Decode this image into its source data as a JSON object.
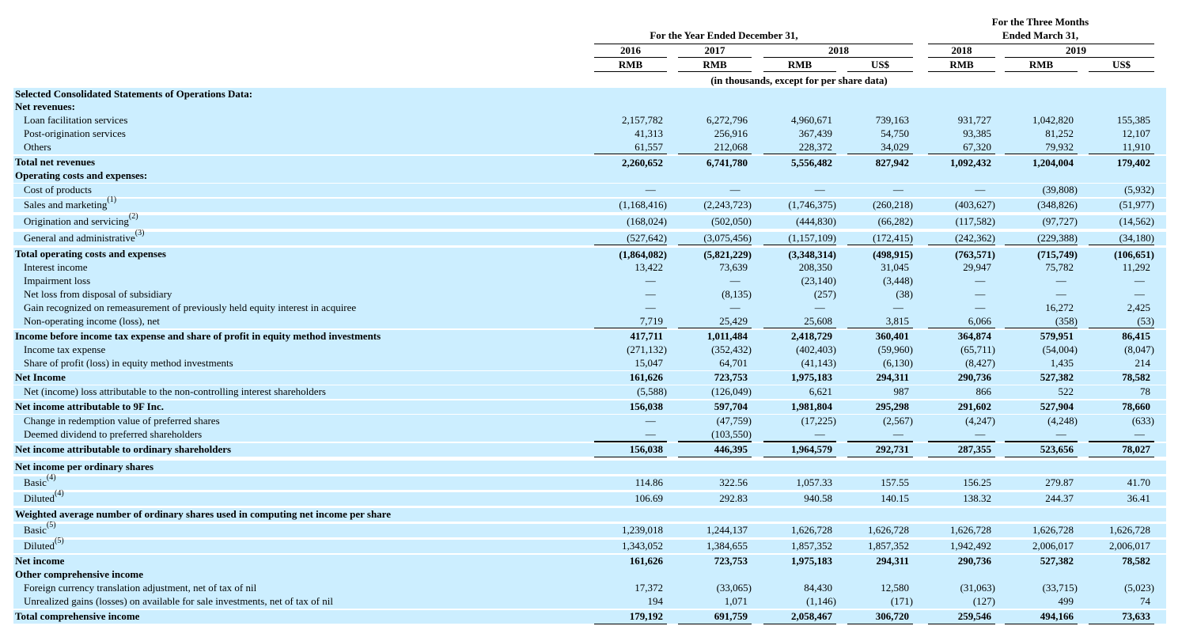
{
  "header": {
    "year_group": "For the Year Ended December 31,",
    "quarter_group_line1": "For the Three Months",
    "quarter_group_line2": "Ended March 31,",
    "year_2018": "2018",
    "quarter_2019": "2019",
    "units_note": "(in thousands, except for per share data)",
    "columns": [
      {
        "year": "2016",
        "currency": "RMB"
      },
      {
        "year": "2017",
        "currency": "RMB"
      },
      {
        "year": "",
        "currency": "RMB"
      },
      {
        "year": "",
        "currency": "US$"
      },
      {
        "year": "2018",
        "currency": "RMB"
      },
      {
        "year": "",
        "currency": "RMB"
      },
      {
        "year": "",
        "currency": "US$"
      }
    ]
  },
  "rows": [
    {
      "label": "Selected Consolidated Statements of Operations Data:",
      "style": "section",
      "values": []
    },
    {
      "label": "Net revenues:",
      "style": "section",
      "values": []
    },
    {
      "label": "Loan facilitation services",
      "style": "item",
      "values": [
        "2,157,782",
        "6,272,796",
        "4,960,671",
        "739,163",
        "931,727",
        "1,042,820",
        "155,385"
      ]
    },
    {
      "label": "Post-origination services",
      "style": "item",
      "values": [
        "41,313",
        "256,916",
        "367,439",
        "54,750",
        "93,385",
        "81,252",
        "12,107"
      ]
    },
    {
      "label": "Others",
      "style": "item",
      "values": [
        "61,557",
        "212,068",
        "228,372",
        "34,029",
        "67,320",
        "79,932",
        "11,910"
      ]
    },
    {
      "label": "Total net revenues",
      "style": "total",
      "values": [
        "2,260,652",
        "6,741,780",
        "5,556,482",
        "827,942",
        "1,092,432",
        "1,204,004",
        "179,402"
      ]
    },
    {
      "label": "Operating costs and expenses:",
      "style": "section",
      "values": []
    },
    {
      "label": "Cost of products",
      "style": "item",
      "values": [
        "—",
        "—",
        "—",
        "—",
        "—",
        "(39,808)",
        "(5,932)"
      ]
    },
    {
      "label": "Sales and marketing",
      "note": "(1)",
      "style": "item",
      "values": [
        "(1,168,416)",
        "(2,243,723)",
        "(1,746,375)",
        "(260,218)",
        "(403,627)",
        "(348,826)",
        "(51,977)"
      ]
    },
    {
      "label": "Origination and servicing",
      "note": "(2)",
      "style": "item",
      "values": [
        "(168,024)",
        "(502,050)",
        "(444,830)",
        "(66,282)",
        "(117,582)",
        "(97,727)",
        "(14,562)"
      ]
    },
    {
      "label": "General and administrative",
      "note": "(3)",
      "style": "item",
      "values": [
        "(527,642)",
        "(3,075,456)",
        "(1,157,109)",
        "(172,415)",
        "(242,362)",
        "(229,388)",
        "(34,180)"
      ]
    },
    {
      "label": "Total operating costs and expenses",
      "style": "total",
      "values": [
        "(1,864,082)",
        "(5,821,229)",
        "(3,348,314)",
        "(498,915)",
        "(763,571)",
        "(715,749)",
        "(106,651)"
      ]
    },
    {
      "label": "Interest income",
      "style": "item",
      "values": [
        "13,422",
        "73,639",
        "208,350",
        "31,045",
        "29,947",
        "75,782",
        "11,292"
      ]
    },
    {
      "label": "Impairment loss",
      "style": "item",
      "values": [
        "—",
        "—",
        "(23,140)",
        "(3,448)",
        "—",
        "—",
        "—"
      ]
    },
    {
      "label": "Net loss from disposal of subsidiary",
      "style": "item",
      "values": [
        "—",
        "(8,135)",
        "(257)",
        "(38)",
        "—",
        "—",
        "—"
      ]
    },
    {
      "label": "Gain recognized on remeasurement of previously held equity interest in acquiree",
      "style": "item",
      "values": [
        "—",
        "—",
        "—",
        "—",
        "—",
        "16,272",
        "2,425"
      ]
    },
    {
      "label": "Non-operating income (loss), net",
      "style": "item",
      "values": [
        "7,719",
        "25,429",
        "25,608",
        "3,815",
        "6,066",
        "(358)",
        "(53)"
      ]
    },
    {
      "label": "Income before income tax expense and share of profit in equity method investments",
      "style": "total",
      "values": [
        "417,711",
        "1,011,484",
        "2,418,729",
        "360,401",
        "364,874",
        "579,951",
        "86,415"
      ]
    },
    {
      "label": "Income tax expense",
      "style": "item",
      "values": [
        "(271,132)",
        "(352,432)",
        "(402,403)",
        "(59,960)",
        "(65,711)",
        "(54,004)",
        "(8,047)"
      ]
    },
    {
      "label": "Share of profit (loss) in equity method investments",
      "style": "item",
      "values": [
        "15,047",
        "64,701",
        "(41,143)",
        "(6,130)",
        "(8,427)",
        "1,435",
        "214"
      ]
    },
    {
      "label": "Net Income",
      "style": "total",
      "values": [
        "161,626",
        "723,753",
        "1,975,183",
        "294,311",
        "290,736",
        "527,382",
        "78,582"
      ]
    },
    {
      "label": "Net (income) loss attributable to the non-controlling interest shareholders",
      "style": "item",
      "values": [
        "(5,588)",
        "(126,049)",
        "6,621",
        "987",
        "866",
        "522",
        "78"
      ]
    },
    {
      "label": "Net income attributable to 9F Inc.",
      "style": "total",
      "values": [
        "156,038",
        "597,704",
        "1,981,804",
        "295,298",
        "291,602",
        "527,904",
        "78,660"
      ]
    },
    {
      "label": "Change in redemption value of preferred shares",
      "style": "item",
      "values": [
        "—",
        "(47,759)",
        "(17,225)",
        "(2,567)",
        "(4,247)",
        "(4,248)",
        "(633)"
      ]
    },
    {
      "label": "Deemed dividend to preferred shareholders",
      "style": "item",
      "values": [
        "—",
        "(103,550)",
        "—",
        "—",
        "—",
        "—",
        "—"
      ]
    },
    {
      "label": "Net income attributable to ordinary shareholders",
      "style": "total",
      "values": [
        "156,038",
        "446,395",
        "1,964,579",
        "292,731",
        "287,355",
        "523,656",
        "78,027"
      ]
    },
    {
      "label": "Net income per ordinary shares",
      "style": "section",
      "values": []
    },
    {
      "label": "Basic",
      "note": "(4)",
      "style": "item",
      "values": [
        "114.86",
        "322.56",
        "1,057.33",
        "157.55",
        "156.25",
        "279.87",
        "41.70"
      ]
    },
    {
      "label": "Diluted",
      "note": "(4)",
      "style": "item",
      "values": [
        "106.69",
        "292.83",
        "940.58",
        "140.15",
        "138.32",
        "244.37",
        "36.41"
      ]
    },
    {
      "label": "Weighted average number of ordinary shares used in computing net income per share",
      "style": "section",
      "values": []
    },
    {
      "label": "Basic",
      "note": "(5)",
      "style": "item",
      "values": [
        "1,239,018",
        "1,244,137",
        "1,626,728",
        "1,626,728",
        "1,626,728",
        "1,626,728",
        "1,626,728"
      ]
    },
    {
      "label": "Diluted",
      "note": "(5)",
      "style": "item",
      "values": [
        "1,343,052",
        "1,384,655",
        "1,857,352",
        "1,857,352",
        "1,942,492",
        "2,006,017",
        "2,006,017"
      ]
    },
    {
      "label": "Net income",
      "style": "total",
      "values": [
        "161,626",
        "723,753",
        "1,975,183",
        "294,311",
        "290,736",
        "527,382",
        "78,582"
      ]
    },
    {
      "label": "Other comprehensive income",
      "style": "section",
      "values": []
    },
    {
      "label": "Foreign currency translation adjustment, net of tax of nil",
      "style": "item",
      "values": [
        "17,372",
        "(33,065)",
        "84,430",
        "12,580",
        "(31,063)",
        "(33,715)",
        "(5,023)"
      ]
    },
    {
      "label": "Unrealized gains (losses) on available for sale investments, net of tax of nil",
      "style": "item",
      "values": [
        "194",
        "1,071",
        "(1,146)",
        "(171)",
        "(127)",
        "499",
        "74"
      ]
    },
    {
      "label": "Total comprehensive income",
      "style": "total",
      "values": [
        "179,192",
        "691,759",
        "2,058,467",
        "306,720",
        "259,546",
        "494,166",
        "73,633"
      ]
    }
  ]
}
